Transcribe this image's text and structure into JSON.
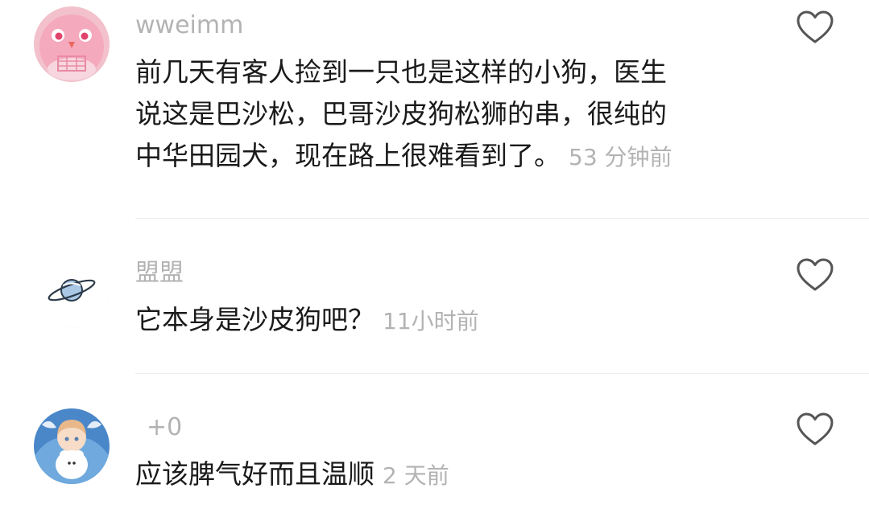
{
  "comments": [
    {
      "username": "wweimm",
      "lines": [
        "前几天有客人捡到一只也是这样的小狗，医生",
        "说这是巴沙松，巴哥沙皮狗松狮的串，很纯的",
        "中华田园犬，现在路上很难看到了。"
      ],
      "time": "53 分钟前",
      "avatar_icon": "pink-bird-avatar-icon"
    },
    {
      "username": "盟盟",
      "lines": [
        "它本身是沙皮狗吧？"
      ],
      "time": "11小时前",
      "avatar_icon": "planet-avatar-icon"
    },
    {
      "username": "+0",
      "lines": [
        "应该脾气好而且温顺"
      ],
      "time": "2 天前",
      "avatar_icon": "anime-girl-avatar-icon"
    }
  ],
  "colors": {
    "meta_text": "#b3b3b3",
    "body_text": "#1a1a1a",
    "divider": "#ececec",
    "like_icon": "#555555"
  }
}
